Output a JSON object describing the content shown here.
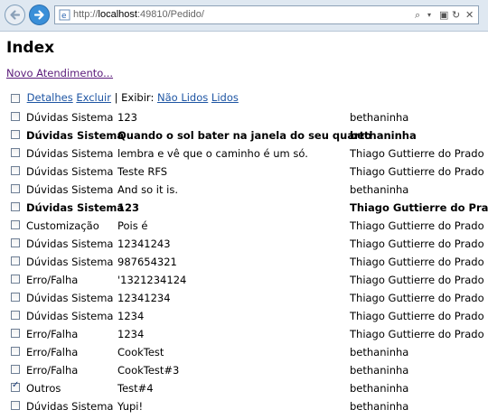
{
  "browser": {
    "url_prefix": "http://",
    "url_host": "localhost",
    "url_rest": ":49810/Pedido/"
  },
  "page": {
    "title": "Index",
    "new_link": "Novo Atendimento...",
    "toolbar": {
      "detalhes": "Detalhes",
      "excluir": "Excluir",
      "separator": "| Exibir:",
      "nao_lidos": "Não Lidos",
      "lidos": "Lidos"
    }
  },
  "rows": [
    {
      "tipo": "Dúvidas Sistema",
      "descricao": "123",
      "usuario": "bethaninha",
      "bold": false,
      "checked": false
    },
    {
      "tipo": "Dúvidas Sistema",
      "descricao": "Quando o sol bater na janela do seu quarto",
      "usuario": "bethaninha",
      "bold": true,
      "checked": false
    },
    {
      "tipo": "Dúvidas Sistema",
      "descricao": "lembra e vê que o caminho é um só.",
      "usuario": "Thiago Guttierre do Prado",
      "bold": false,
      "checked": false
    },
    {
      "tipo": "Dúvidas Sistema",
      "descricao": "Teste RFS",
      "usuario": "Thiago Guttierre do Prado",
      "bold": false,
      "checked": false
    },
    {
      "tipo": "Dúvidas Sistema",
      "descricao": "And so it is.",
      "usuario": "bethaninha",
      "bold": false,
      "checked": false
    },
    {
      "tipo": "Dúvidas Sistema",
      "descricao": "123",
      "usuario": "Thiago Guttierre do Prado",
      "bold": true,
      "checked": false
    },
    {
      "tipo": "Customização",
      "descricao": "Pois é",
      "usuario": "Thiago Guttierre do Prado",
      "bold": false,
      "checked": false
    },
    {
      "tipo": "Dúvidas Sistema",
      "descricao": "12341243",
      "usuario": "Thiago Guttierre do Prado",
      "bold": false,
      "checked": false
    },
    {
      "tipo": "Dúvidas Sistema",
      "descricao": "987654321",
      "usuario": "Thiago Guttierre do Prado",
      "bold": false,
      "checked": false
    },
    {
      "tipo": "Erro/Falha",
      "descricao": "'1321234124",
      "usuario": "Thiago Guttierre do Prado",
      "bold": false,
      "checked": false
    },
    {
      "tipo": "Dúvidas Sistema",
      "descricao": "12341234",
      "usuario": "Thiago Guttierre do Prado",
      "bold": false,
      "checked": false
    },
    {
      "tipo": "Dúvidas Sistema",
      "descricao": "1234",
      "usuario": "Thiago Guttierre do Prado",
      "bold": false,
      "checked": false
    },
    {
      "tipo": "Erro/Falha",
      "descricao": "1234",
      "usuario": "Thiago Guttierre do Prado",
      "bold": false,
      "checked": false
    },
    {
      "tipo": "Erro/Falha",
      "descricao": "CookTest",
      "usuario": "bethaninha",
      "bold": false,
      "checked": false
    },
    {
      "tipo": "Erro/Falha",
      "descricao": "CookTest#3",
      "usuario": "bethaninha",
      "bold": false,
      "checked": false
    },
    {
      "tipo": "Outros",
      "descricao": "Test#4",
      "usuario": "bethaninha",
      "bold": false,
      "checked": true
    },
    {
      "tipo": "Dúvidas Sistema",
      "descricao": "Yupi!",
      "usuario": "bethaninha",
      "bold": false,
      "checked": false
    }
  ]
}
